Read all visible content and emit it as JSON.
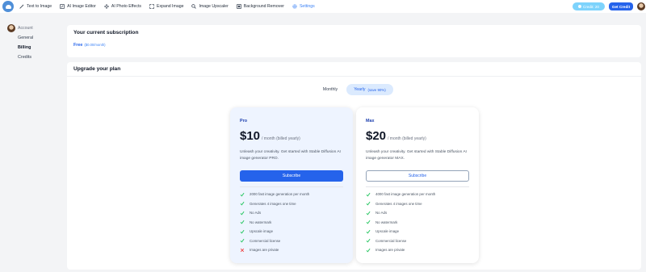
{
  "nav": {
    "items": [
      {
        "label": "Text to Image",
        "icon": "wand-icon",
        "active": false
      },
      {
        "label": "AI Image Editor",
        "icon": "image-edit-icon",
        "active": false
      },
      {
        "label": "AI Photo Effects",
        "icon": "sparkle-icon",
        "active": false
      },
      {
        "label": "Expand Image",
        "icon": "expand-icon",
        "active": false
      },
      {
        "label": "Image Upscaler",
        "icon": "upscale-icon",
        "active": false
      },
      {
        "label": "Background Remover",
        "icon": "background-remove-icon",
        "active": false
      },
      {
        "label": "Settings",
        "icon": "gear-icon",
        "active": true
      }
    ],
    "credit_label": "Credit: 20",
    "get_credit_label": "Get Credit"
  },
  "sidebar": {
    "account_label": "Account",
    "items": [
      {
        "label": "General",
        "active": false
      },
      {
        "label": "Billing",
        "active": true
      },
      {
        "label": "Credits",
        "active": false
      }
    ]
  },
  "subscription": {
    "title": "Your current subscription",
    "plan": "Free",
    "price": "($0.00/month)"
  },
  "upgrade": {
    "title": "Upgrade your plan",
    "toggle_monthly": "Monthly",
    "toggle_yearly": "Yearly",
    "toggle_save": "(save 90%)",
    "plans": [
      {
        "name": "Pro",
        "price": "$10",
        "period": "/ month (billed yearly)",
        "description": "Unleash your creativity. Get started with Stable Diffusion AI image generator PRO.",
        "button": "Subscribe",
        "features": [
          {
            "text": "2000 fast image generation per month",
            "included": true
          },
          {
            "text": "Generates 4 images one time",
            "included": true
          },
          {
            "text": "No Ads",
            "included": true
          },
          {
            "text": "No watermark",
            "included": true
          },
          {
            "text": "Upscale image",
            "included": true
          },
          {
            "text": "Commercial license",
            "included": true
          },
          {
            "text": "Images are private",
            "included": false
          }
        ]
      },
      {
        "name": "Max",
        "price": "$20",
        "period": "/ month (billed yearly)",
        "description": "Unleash your creativity. Get started with Stable Diffusion AI image generator MAX.",
        "button": "Subscribe",
        "features": [
          {
            "text": "4000 fast image generation per month",
            "included": true
          },
          {
            "text": "Generates 4 images one time",
            "included": true
          },
          {
            "text": "No Ads",
            "included": true
          },
          {
            "text": "No watermark",
            "included": true
          },
          {
            "text": "Upscale image",
            "included": true
          },
          {
            "text": "Commercial license",
            "included": true
          },
          {
            "text": "Images are private",
            "included": true
          }
        ]
      }
    ]
  },
  "colors": {
    "accent": "#2563eb",
    "credit_pill": "#7dd3fc",
    "check": "#22c55e",
    "cross": "#ef4444"
  }
}
